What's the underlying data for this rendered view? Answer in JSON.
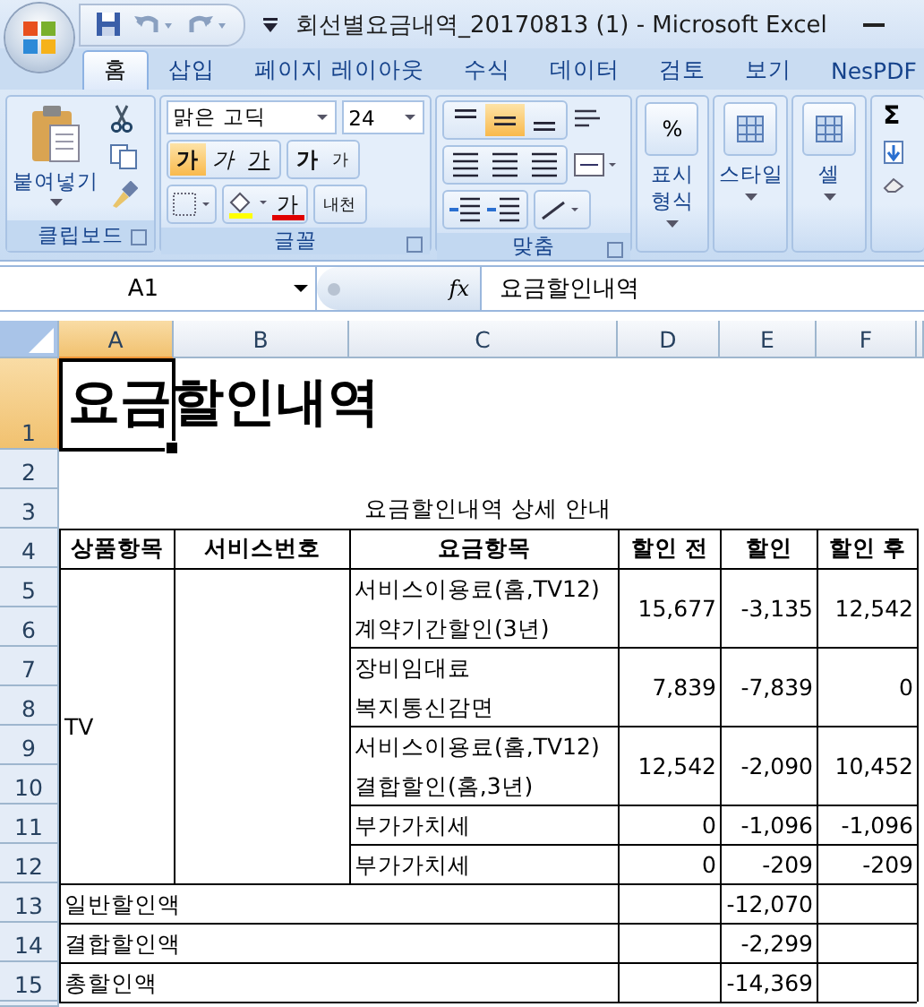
{
  "window": {
    "title": "회선별요금내역_20170813 (1)  -  Microsoft Excel"
  },
  "tabs": [
    {
      "label": "홈",
      "selected": true
    },
    {
      "label": "삽입",
      "selected": false
    },
    {
      "label": "페이지 레이아웃",
      "selected": false
    },
    {
      "label": "수식",
      "selected": false
    },
    {
      "label": "데이터",
      "selected": false
    },
    {
      "label": "검토",
      "selected": false
    },
    {
      "label": "보기",
      "selected": false
    },
    {
      "label": "NesPDF",
      "selected": false
    }
  ],
  "ribbon": {
    "groups": [
      {
        "kind": "clipboard",
        "label": "클립보드",
        "paste": "붙여넣기"
      },
      {
        "kind": "font",
        "label": "글꼴",
        "font_name": "맑은 고딕",
        "font_size": "24",
        "style_buttons": [
          {
            "kind": "bold",
            "label": "가",
            "selected": true
          },
          {
            "kind": "italic",
            "label": "가",
            "selected": false
          },
          {
            "kind": "underline",
            "label": "가",
            "selected": false
          }
        ],
        "size_buttons": [
          "가",
          "가"
        ],
        "font_color": "가",
        "phonetic": "내천"
      },
      {
        "kind": "alignment",
        "label": "맞춤",
        "vertical_align": [
          {
            "selected": false
          },
          {
            "selected": true
          },
          {
            "selected": false
          }
        ]
      },
      {
        "kind": "collapsed",
        "icon": "%",
        "label": "표시\n형식"
      },
      {
        "kind": "collapsed",
        "label": "스타일"
      },
      {
        "kind": "collapsed",
        "label": "셀"
      },
      {
        "kind": "editing",
        "icon": "Σ"
      }
    ]
  },
  "formula_bar": {
    "name_box": "A1",
    "fx": "fx",
    "value": "요금할인내역"
  },
  "sheet": {
    "columns": [
      {
        "label": "A",
        "selected": true
      },
      {
        "label": "B",
        "selected": false
      },
      {
        "label": "C",
        "selected": false
      },
      {
        "label": "D",
        "selected": false
      },
      {
        "label": "E",
        "selected": false
      },
      {
        "label": "F",
        "selected": false
      }
    ],
    "rows": [
      {
        "label": "1",
        "selected": true
      },
      {
        "label": "2",
        "selected": false
      },
      {
        "label": "3",
        "selected": false
      },
      {
        "label": "4",
        "selected": false
      },
      {
        "label": "5",
        "selected": false
      },
      {
        "label": "6",
        "selected": false
      },
      {
        "label": "7",
        "selected": false
      },
      {
        "label": "8",
        "selected": false
      },
      {
        "label": "9",
        "selected": false
      },
      {
        "label": "10",
        "selected": false
      },
      {
        "label": "11",
        "selected": false
      },
      {
        "label": "12",
        "selected": false
      },
      {
        "label": "13",
        "selected": false
      },
      {
        "label": "14",
        "selected": false
      },
      {
        "label": "15",
        "selected": false
      }
    ],
    "cells": [
      {
        "kind": "title",
        "text": "요금할인내역"
      },
      {
        "kind": "caption",
        "text": "요금할인내역 상세 안내"
      },
      {
        "kind": "header",
        "text": "상품항목"
      },
      {
        "kind": "header",
        "text": "서비스번호"
      },
      {
        "kind": "header",
        "text": "요금항목"
      },
      {
        "kind": "header",
        "text": "할인 전"
      },
      {
        "kind": "header",
        "text": "할인"
      },
      {
        "kind": "header",
        "text": "할인 후"
      },
      {
        "kind": "text",
        "text": "TV"
      },
      {
        "kind": "text",
        "text": "서비스이용료(홈,TV12)\n계약기간할인(3년)"
      },
      {
        "kind": "number",
        "text": "15,677"
      },
      {
        "kind": "number",
        "text": "-3,135"
      },
      {
        "kind": "number",
        "text": "12,542"
      },
      {
        "kind": "text",
        "text": "장비임대료\n복지통신감면"
      },
      {
        "kind": "number",
        "text": "7,839"
      },
      {
        "kind": "number",
        "text": "-7,839"
      },
      {
        "kind": "number",
        "text": "0"
      },
      {
        "kind": "text",
        "text": "서비스이용료(홈,TV12)\n결합할인(홈,3년)"
      },
      {
        "kind": "number",
        "text": "12,542"
      },
      {
        "kind": "number",
        "text": "-2,090"
      },
      {
        "kind": "number",
        "text": "10,452"
      },
      {
        "kind": "text",
        "text": "부가가치세"
      },
      {
        "kind": "number",
        "text": "0"
      },
      {
        "kind": "number",
        "text": "-1,096"
      },
      {
        "kind": "number",
        "text": "-1,096"
      },
      {
        "kind": "text",
        "text": "부가가치세"
      },
      {
        "kind": "number",
        "text": "0"
      },
      {
        "kind": "number",
        "text": "-209"
      },
      {
        "kind": "number",
        "text": "-209"
      },
      {
        "kind": "text",
        "text": "일반할인액"
      },
      {
        "kind": "number",
        "text": "-12,070"
      },
      {
        "kind": "text",
        "text": "결합할인액"
      },
      {
        "kind": "number",
        "text": "-2,299"
      },
      {
        "kind": "text",
        "text": "총할인액"
      },
      {
        "kind": "number",
        "text": "-14,369"
      }
    ]
  }
}
